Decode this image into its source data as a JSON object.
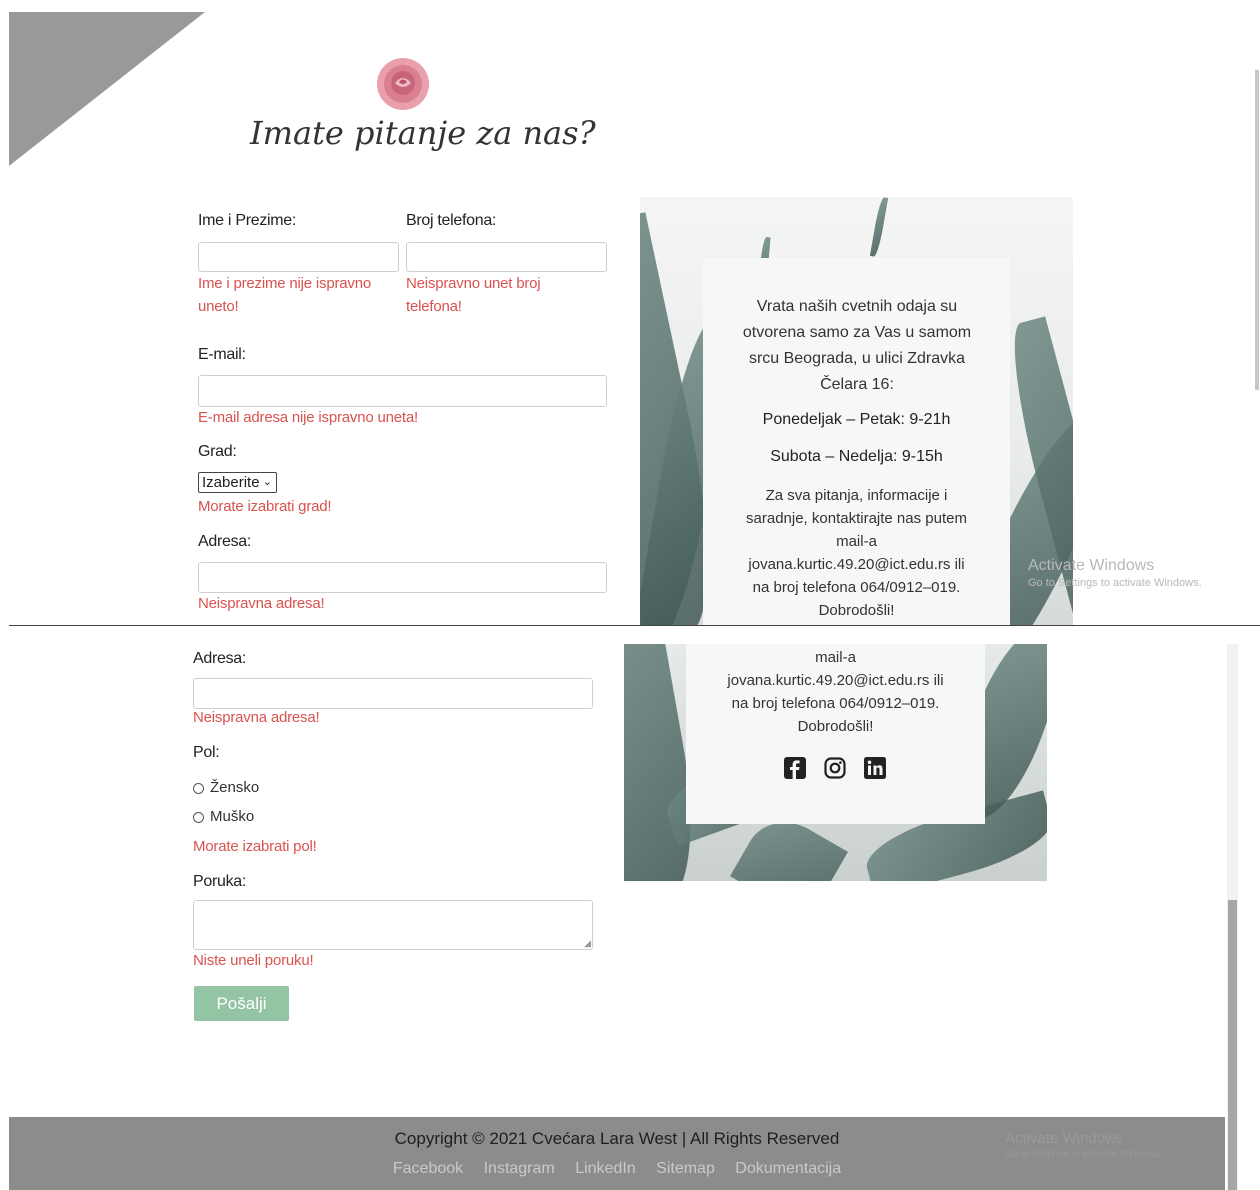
{
  "header": {
    "title": "Imate pitanje za nas?"
  },
  "form": {
    "name_label": "Ime i Prezime:",
    "name_error": "Ime i prezime nije ispravno uneto!",
    "phone_label": "Broj telefona:",
    "phone_error": "Neispravno unet broj telefona!",
    "email_label": "E-mail:",
    "email_error": "E-mail adresa nije ispravno uneta!",
    "city_label": "Grad:",
    "city_selected": "Izaberite",
    "city_error": "Morate izabrati grad!",
    "address_label": "Adresa:",
    "address_error": "Neispravna adresa!",
    "gender_label": "Pol:",
    "gender_options": [
      "Žensko",
      "Muško"
    ],
    "gender_error": "Morate izabrati pol!",
    "message_label": "Poruka:",
    "message_error": "Niste uneli poruku!",
    "submit_label": "Pošalji"
  },
  "info": {
    "intro": "Vrata naših cvetnih odaja su otvorena samo za Vas u samom srcu Beograda, u ulici Zdravka Čelara 16:",
    "hours_weekday": "Ponedeljak – Petak: 9-21h",
    "hours_weekend": "Subota – Nedelja: 9-15h",
    "contact_line1": "Za sva pitanja, informacije i saradnje, kontaktirajte nas putem",
    "contact_line2": "mail-a",
    "contact_line3": "jovana.kurtic.49.20@ict.edu.rs ili",
    "contact_line4": "na broj telefona 064/0912–019.",
    "contact_line5": "Dobrodošli!"
  },
  "social": {
    "icons": [
      "facebook-icon",
      "instagram-icon",
      "linkedin-icon"
    ]
  },
  "watermark": {
    "title": "Activate Windows",
    "subtitle": "Go to Settings to activate Windows."
  },
  "footer": {
    "copyright": "Copyright © 2021 Cvećara Lara West | All Rights Reserved",
    "links": [
      "Facebook",
      "Instagram",
      "LinkedIn",
      "Sitemap",
      "Dokumentacija"
    ]
  },
  "colors": {
    "error": "#d9534f",
    "submit_bg": "#93c4a4",
    "footer_bg": "#8c8c8c",
    "triangle": "#999999"
  }
}
